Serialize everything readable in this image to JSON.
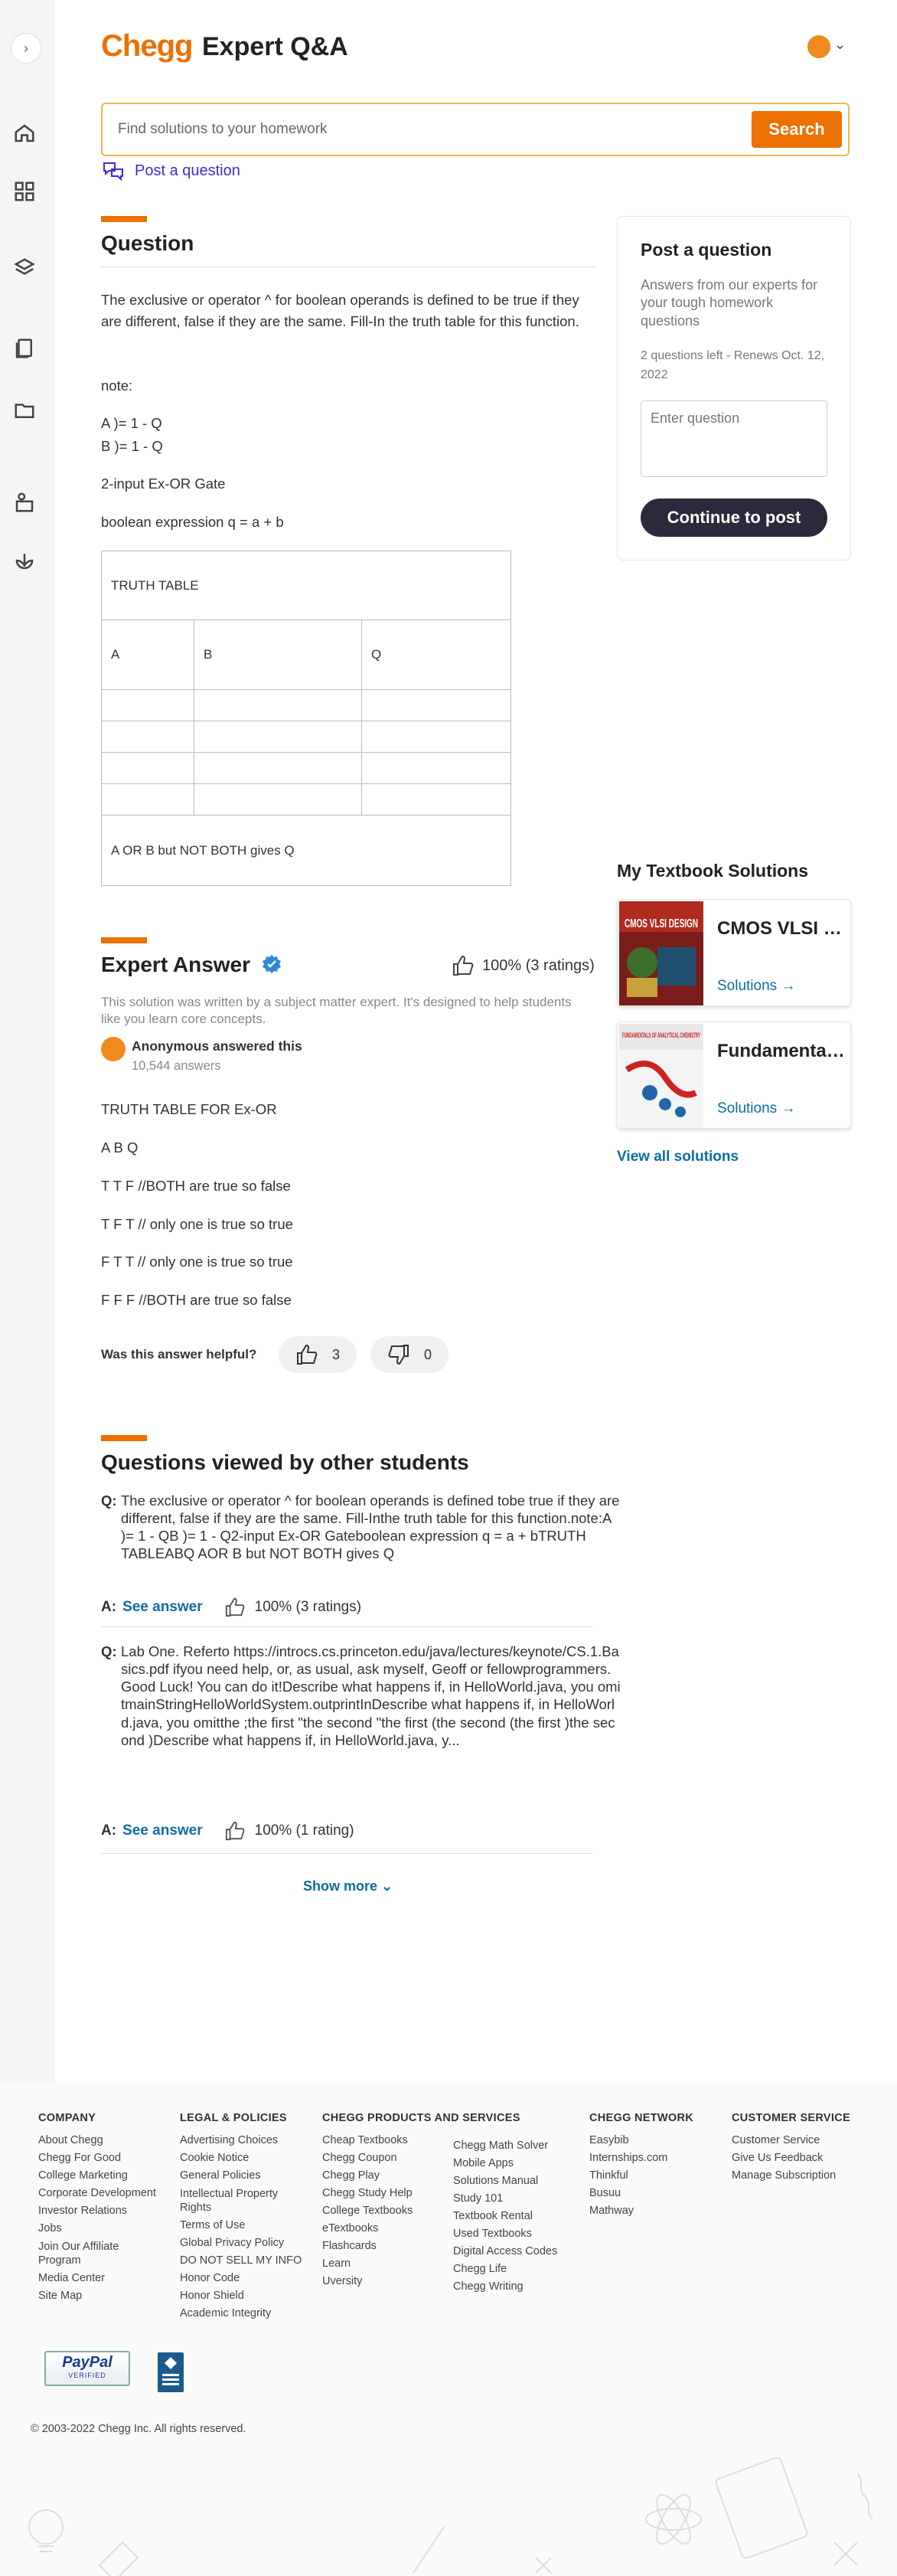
{
  "header": {
    "logo": "Chegg",
    "title": "Expert Q&A",
    "search_placeholder": "Find solutions to your homework",
    "search_button": "Search",
    "post_link": "Post a question"
  },
  "question": {
    "heading": "Question",
    "paragraphs": [
      "The exclusive or operator ^ for boolean operands is defined to be true if they are different, false if they are the same. Fill-In the truth table for this function.",
      "note:",
      "A )= 1 - Q",
      "B )= 1 - Q",
      "2-input Ex-OR Gate",
      "boolean expression q = a + b"
    ],
    "table": {
      "title": "TRUTH TABLE",
      "headers": [
        "A",
        "B",
        "Q"
      ],
      "footer": "A OR B but NOT BOTH gives Q"
    }
  },
  "post_card": {
    "title": "Post a question",
    "description": "Answers from our experts for your tough homework questions",
    "questions_left": "2 questions left - Renews Oct. 12, 2022",
    "placeholder": "Enter question",
    "button": "Continue to post"
  },
  "textbooks": {
    "title": "My Textbook Solutions",
    "items": [
      {
        "name": "CMOS VLSI Design",
        "cover_text": "CMOS VLSI DESIGN",
        "link": "Solutions →"
      },
      {
        "name": "Fundamentals of Analytical Chemistry",
        "cover_text": "FUNDAMENTALS OF ANALYTICAL CHEMISTRY",
        "link": "Solutions →"
      }
    ],
    "view_all": "View all solutions"
  },
  "answer": {
    "heading": "Expert Answer",
    "rating": "100% (3 ratings)",
    "disclaimer": "This solution was written by a subject matter expert. It's designed to help students like you learn core concepts.",
    "author": "Anonymous answered this",
    "author_count": "10,544 answers",
    "lines": [
      "TRUTH TABLE FOR Ex-OR",
      "A B Q",
      "T T F //BOTH are true so false",
      "T F T // only one is true so true",
      "F T T // only one is true so true",
      "F F F //BOTH are true so false"
    ],
    "helpful_label": "Was this answer helpful?",
    "likes": "3",
    "dislikes": "0"
  },
  "viewed": {
    "heading": "Questions viewed by other students",
    "items": [
      {
        "q_label": "Q:",
        "text": "The exclusive or operator ^ for boolean operands is defined tobe true if they are different, false if they are the same. Fill-Inthe truth table for this function.note:A )= 1 - QB )= 1 - Q2-input Ex-OR Gateboolean expression q = a + bTRUTH TABLEABQ AOR B but NOT BOTH gives Q",
        "a_label": "A:",
        "see_answer": "See answer",
        "rating": "100% (3 ratings)"
      },
      {
        "q_label": "Q:",
        "text": "Lab One. Referto https://introcs.cs.princeton.edu/java/lectures/keynote/CS.1.Basics.pdf ifyou need help, or, as usual, ask myself, Geoff or fellowprogrammers. Good Luck! You can do it!Describe what happens if, in HelloWorld.java, you omitmainStringHelloWorldSystem.outprintInDescribe what happens if, in HelloWorld.java, you omitthe ;the first \"the second \"the first (the second (the first )the second )Describe what happens if, in HelloWorld.java, y...",
        "a_label": "A:",
        "see_answer": "See answer",
        "rating": "100% (1 rating)"
      }
    ],
    "show_more": "Show more"
  },
  "footer": {
    "columns": [
      {
        "title": "COMPANY",
        "links": [
          "About Chegg",
          "Chegg For Good",
          "College Marketing",
          "Corporate Development",
          "Investor Relations",
          "Jobs",
          "Join Our Affiliate Program",
          "Media Center",
          "Site Map"
        ]
      },
      {
        "title": "LEGAL & POLICIES",
        "links": [
          "Advertising Choices",
          "Cookie Notice",
          "General Policies",
          "Intellectual Property Rights",
          "Terms of Use",
          "Global Privacy Policy",
          "DO NOT SELL MY INFO",
          "Honor Code",
          "Honor Shield",
          "Academic Integrity"
        ]
      },
      {
        "title": "CHEGG PRODUCTS AND SERVICES",
        "links": [
          "Cheap Textbooks",
          "Chegg Coupon",
          "Chegg Play",
          "Chegg Study Help",
          "College Textbooks",
          "eTextbooks",
          "Flashcards",
          "Learn",
          "Uversity"
        ]
      },
      {
        "title": "",
        "links": [
          "Chegg Math Solver",
          "Mobile Apps",
          "Solutions Manual",
          "Study 101",
          "Textbook Rental",
          "Used Textbooks",
          "Digital Access Codes",
          "Chegg Life",
          "Chegg Writing"
        ]
      },
      {
        "title": "CHEGG NETWORK",
        "links": [
          "Easybib",
          "Internships.com",
          "Thinkful",
          "Busuu",
          "Mathway"
        ]
      },
      {
        "title": "CUSTOMER SERVICE",
        "links": [
          "Customer Service",
          "Give Us Feedback",
          "Manage Subscription"
        ]
      }
    ],
    "paypal": "PayPal",
    "paypal_sub": "VERIFIED",
    "copyright": "© 2003-2022 Chegg Inc. All rights reserved."
  },
  "colors": {
    "brand": "#eb7100",
    "link": "#0c6e9e",
    "post_link": "#3b2fcf",
    "dark_button": "#2a2a3c"
  }
}
